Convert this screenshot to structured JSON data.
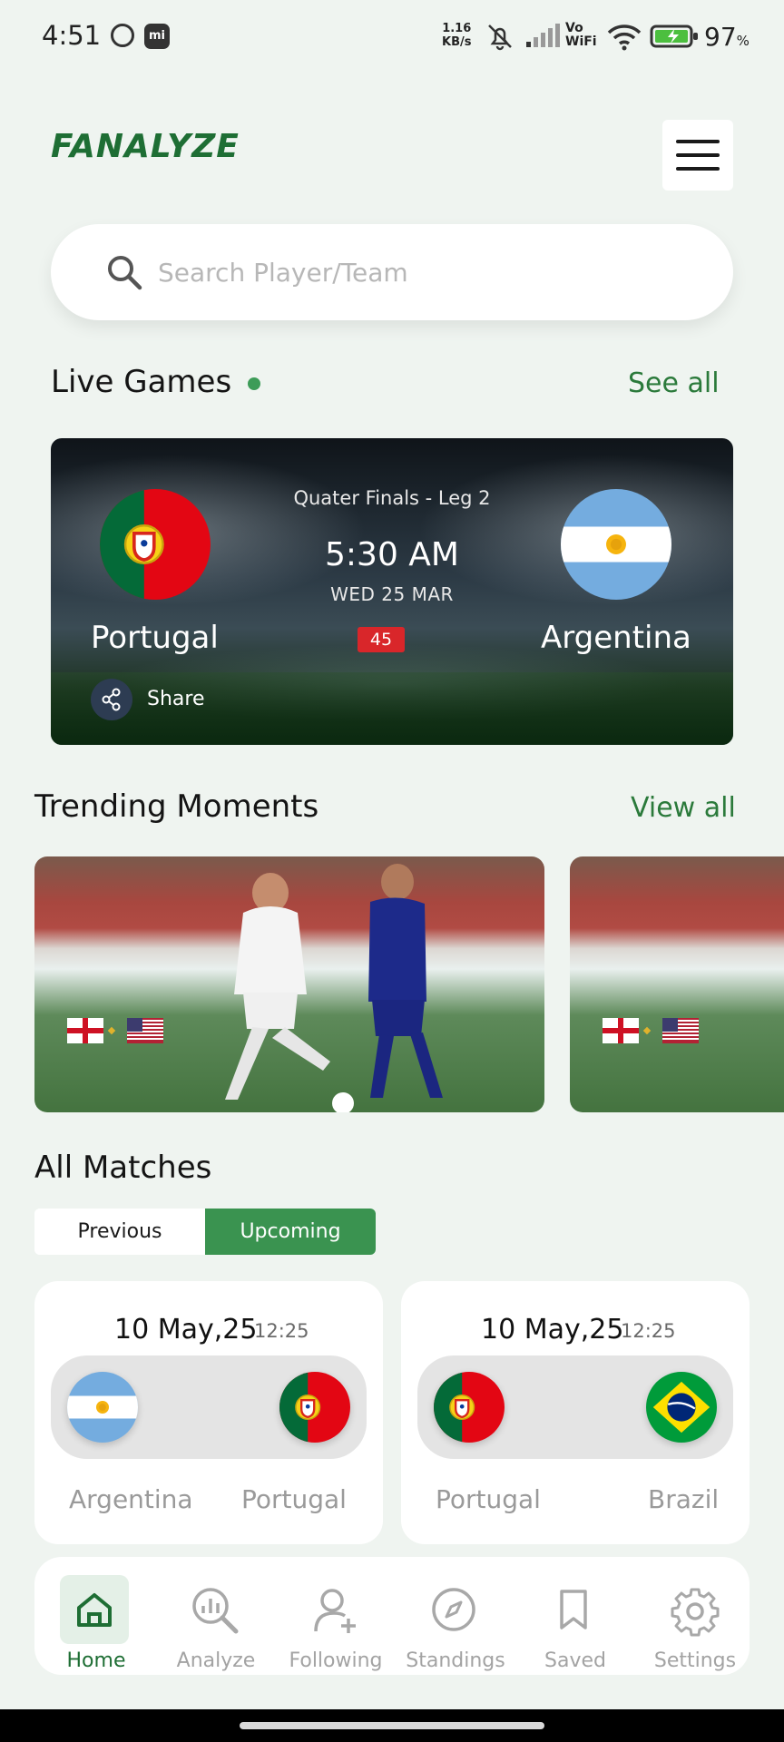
{
  "status_bar": {
    "time": "4:51",
    "app_badge": "mi",
    "net_speed_value": "1.16",
    "net_speed_unit": "KB/s",
    "vowifi_top": "Vo",
    "vowifi_bottom": "WiFi",
    "battery": "97",
    "battery_unit": "%"
  },
  "header": {
    "logo": "FANALYZE",
    "brand_color": "#1e6e34"
  },
  "search": {
    "placeholder": "Search Player/Team",
    "value": ""
  },
  "live_games": {
    "title": "Live Games",
    "see_all": "See all",
    "status_color": "#3d9c58",
    "match": {
      "stage": "Quater Finals - Leg 2",
      "time": "5:30 AM",
      "date": "WED 25 MAR",
      "minute": "45",
      "home_team": "Portugal",
      "away_team": "Argentina",
      "home_flag": "portugal-flag",
      "away_flag": "argentina-flag",
      "share": "Share"
    }
  },
  "trending": {
    "title": "Trending Moments",
    "view_all": "View all",
    "moments": [
      {
        "flags": [
          "england-flag",
          "usa-flag"
        ]
      },
      {
        "flags": [
          "england-flag",
          "usa-flag"
        ]
      }
    ]
  },
  "all_matches": {
    "title": "All Matches",
    "tabs": [
      "Previous",
      "Upcoming"
    ],
    "selected_tab": "Upcoming",
    "accent_color": "#3a9350",
    "matches": [
      {
        "date": "10 May,25",
        "time": "12:25",
        "home": "Argentina",
        "away": "Portugal",
        "home_flag": "argentina-flag",
        "away_flag": "portugal-flag"
      },
      {
        "date": "10 May,25",
        "time": "12:25",
        "home": "Portugal",
        "away": "Brazil",
        "home_flag": "portugal-flag",
        "away_flag": "brazil-flag"
      }
    ]
  },
  "bottom_nav": {
    "active": "Home",
    "items": [
      {
        "label": "Home",
        "icon": "home-icon"
      },
      {
        "label": "Analyze",
        "icon": "analyze-icon"
      },
      {
        "label": "Following",
        "icon": "add-user-icon"
      },
      {
        "label": "Standings",
        "icon": "compass-icon"
      },
      {
        "label": "Saved",
        "icon": "bookmark-icon"
      },
      {
        "label": "Settings",
        "icon": "gear-icon"
      }
    ]
  }
}
